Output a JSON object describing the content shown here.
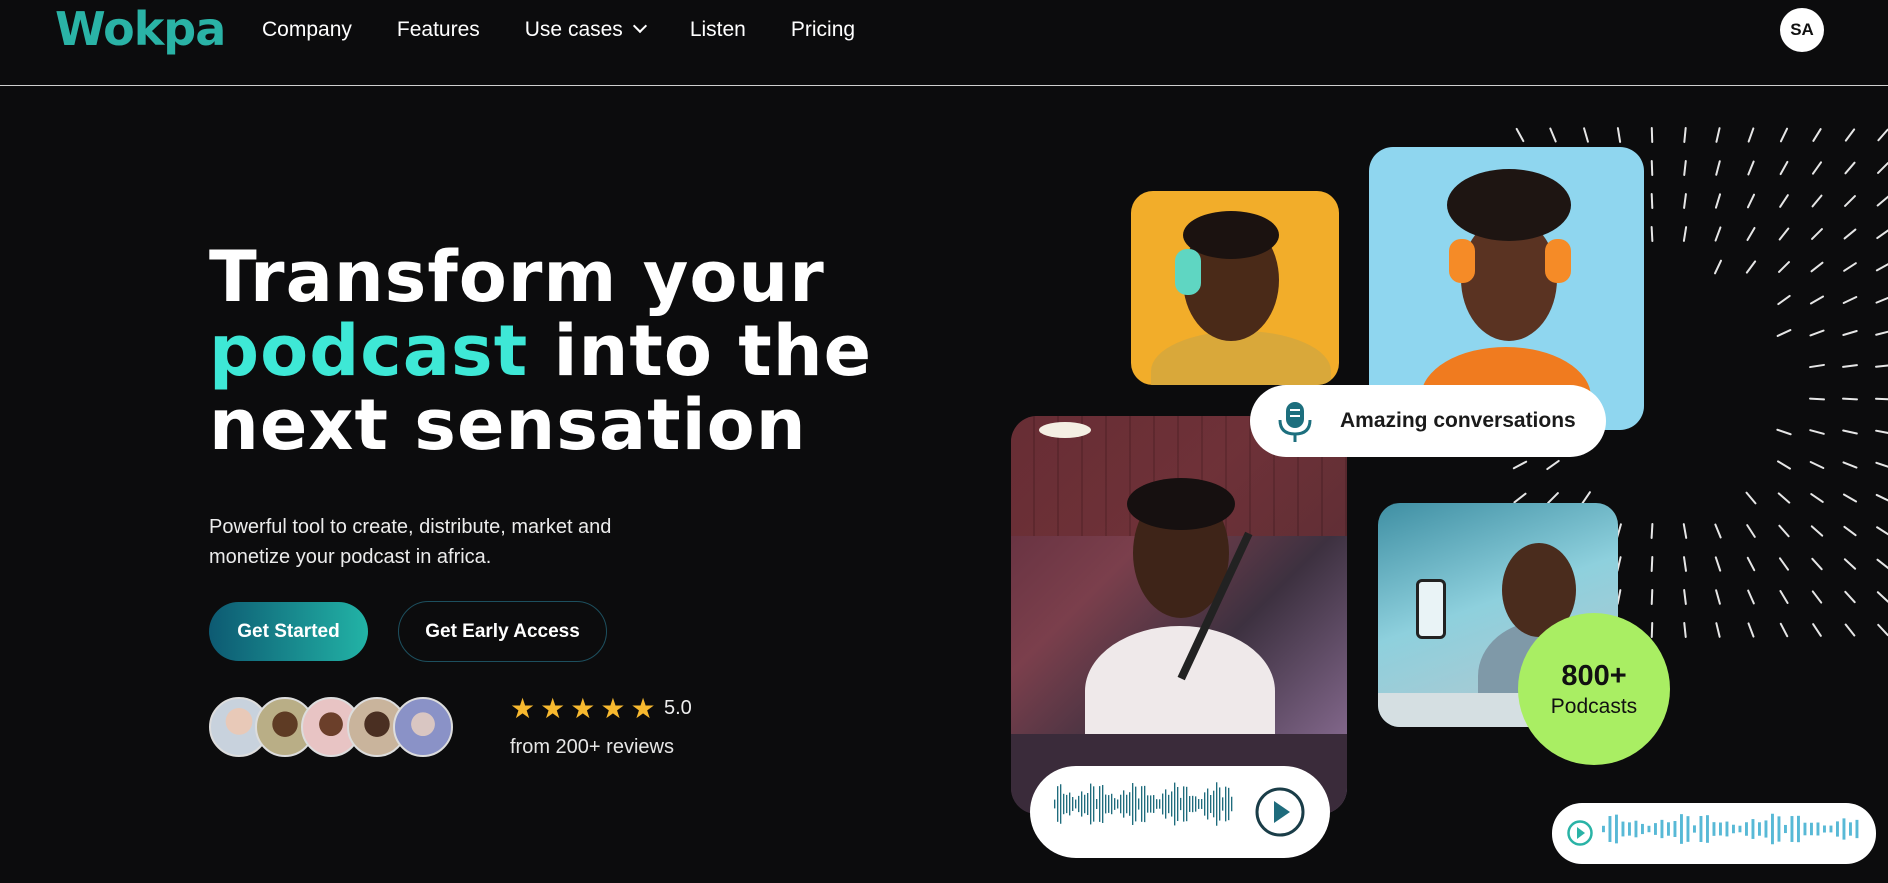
{
  "brand": {
    "logo": "Wokpa",
    "accent": "#3ee8d6",
    "logo_color": "#2ab3a6"
  },
  "nav": {
    "items": [
      {
        "label": "Company"
      },
      {
        "label": "Features"
      },
      {
        "label": "Use cases",
        "has_dropdown": true
      },
      {
        "label": "Listen"
      },
      {
        "label": "Pricing"
      }
    ],
    "avatar_initials": "SA"
  },
  "hero": {
    "title_line1": "Transform your",
    "title_accent": "podcast",
    "title_line2_rest": " into the",
    "title_line3": "next sensation",
    "subtitle": "Powerful tool to create, distribute, market and monetize your podcast in africa.",
    "primary_cta": "Get Started",
    "secondary_cta": "Get Early Access"
  },
  "reviews": {
    "stars": 5,
    "rating": "5.0",
    "text": "from 200+ reviews",
    "avatar_count": 5
  },
  "cards": {
    "conversation_label": "Amazing conversations",
    "stat_number": "800+",
    "stat_label": "Podcasts"
  },
  "icons": [
    "chevron-down-icon",
    "microphone-icon",
    "play-icon",
    "star-icon"
  ],
  "colors": {
    "background": "#0c0c0d",
    "stat_badge": "#a9ee63",
    "star": "#f7b92f"
  }
}
